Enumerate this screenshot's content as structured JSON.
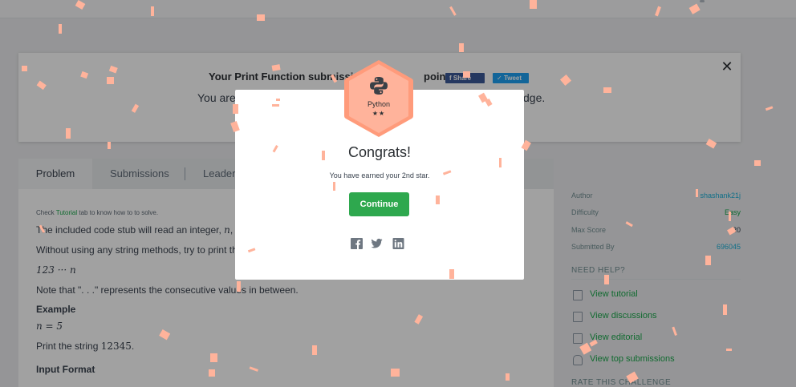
{
  "banner": {
    "headline_start": "Your Print Function submissio",
    "headline_end": "points.",
    "share_label": "Share",
    "tweet_label": "Tweet",
    "subline_start": "You are",
    "subline_end": "dge."
  },
  "tabs": [
    {
      "label": "Problem"
    },
    {
      "label": "Submissions"
    },
    {
      "label": "Leaderb"
    }
  ],
  "problem": {
    "check_prefix": "Check ",
    "check_link": "Tutorial",
    "check_suffix": " tab to know how to to solve.",
    "line1_start": "The included code stub will read an integer, ",
    "line1_var": "n",
    "line1_end": ", from",
    "line2": "Without using any string methods, try to print the f",
    "formula": "123 ··· n",
    "note": "Note that \". . .\" represents the consecutive values in between.",
    "example_heading": "Example",
    "example_value": "n = 5",
    "print_prefix": "Print the string ",
    "print_value": "12345",
    "print_suffix": ".",
    "input_heading": "Input Format"
  },
  "sidebar": {
    "author_label": "Author",
    "author_value": "shashank21j",
    "difficulty_label": "Difficulty",
    "difficulty_value": "Easy",
    "maxscore_label": "Max Score",
    "maxscore_value": "20",
    "submitted_label": "Submitted By",
    "submitted_value": "696045",
    "help_title": "NEED HELP?",
    "help_items": [
      {
        "label": "View tutorial"
      },
      {
        "label": "View discussions"
      },
      {
        "label": "View editorial"
      },
      {
        "label": "View top submissions"
      }
    ],
    "rate_title": "RATE THIS CHALLENGE"
  },
  "modal": {
    "badge_name": "Python",
    "badge_stars": "★★",
    "title": "Congrats!",
    "message": "You have earned your 2nd star.",
    "continue_label": "Continue"
  },
  "colors": {
    "accent_green": "#2ea84e",
    "badge_orange": "#ff9b7b",
    "confetti": "#ffb39b",
    "facebook": "#3b5998",
    "twitter": "#1da1f2"
  }
}
